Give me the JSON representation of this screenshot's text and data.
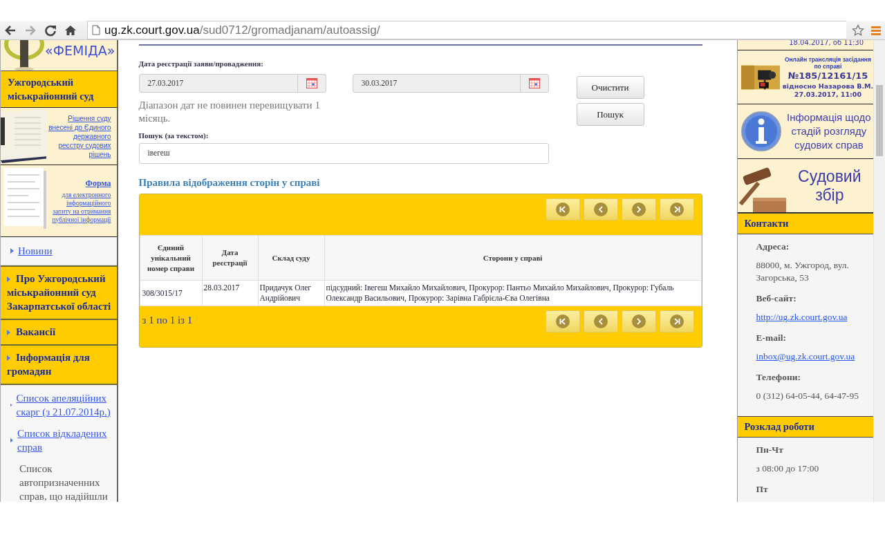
{
  "browser": {
    "url_host": "ug.zk.court.gov.ua",
    "url_path": "/sud0712/gromadjanam/autoassig/"
  },
  "left_sidebar": {
    "logo": "«ФЕМІДА»",
    "court_title": "Ужгородський міськрайонний суд",
    "banners": [
      {
        "kind": "book",
        "text": "Рішення суду внесені до Єдиного державного реєстру судових рішень"
      },
      {
        "kind": "form",
        "title": "Форма",
        "text": "для електронного інформаційного запиту на отримання публічної інформації"
      }
    ],
    "menu": [
      {
        "label": "Новини",
        "kind": "link"
      },
      {
        "label": "Про Ужгородський міськрайонний суд Закарпатської області",
        "kind": "section"
      },
      {
        "label": "Вакансії",
        "kind": "section"
      },
      {
        "label": "Інформація для громадян",
        "kind": "section",
        "children": [
          {
            "label": "Список апеляційних скарг (з 21.07.2014р.)",
            "kind": "link"
          },
          {
            "label": "Список відкладених справ",
            "kind": "link"
          },
          {
            "label": "Список автопризначенних справ, що надійшли",
            "kind": "current"
          }
        ]
      }
    ]
  },
  "form": {
    "date_label": "Дата реєстрації заяви/провадження:",
    "date_from": "27.03.2017",
    "date_to": "30.03.2017",
    "hint": "Діапазон дат не повинен перевищувати 1 місяць.",
    "text_label": "Пошук (за текстом):",
    "text_value": "івегеш",
    "buttons": [
      "Очистити",
      "Пошук"
    ]
  },
  "rules_link": "Правила відображення сторін у справі",
  "table": {
    "columns": [
      "Єдиний унікальний номер справи",
      "Дата реєстрації",
      "Склад суду",
      "Сторони у справі"
    ],
    "rows": [
      [
        "308/3015/17",
        "28.03.2017",
        "Придачук Олег Андрійович",
        "підсудний: Івегеш Михайло Михайлович, Прокурор: Пантьо Михайло Михайлович, Прокурор: Губаль Олександр Васильович, Прокурор: Зарівна Габрієла-Єва Олегівна"
      ]
    ],
    "pager_text": "з 1 по 1 із 1"
  },
  "right_sidebar": {
    "top_banner": "18.04.2017, об 11:30",
    "stream_banner": {
      "title": "Онлайн трансляція засідання по справі",
      "case": "№185/12161/15",
      "subject": "відносно Назарова В.М.",
      "date": "27.03.2017, 11:00"
    },
    "info_banner": "Інформація щодо стадій розгляду судових справ",
    "fee_banner": "Судовий збір",
    "sections": [
      {
        "heading": "Контакти",
        "items": [
          {
            "label": "Адреса:",
            "value": "88000, м. Ужгород, вул. Загорська, 53",
            "kind": "text"
          },
          {
            "label": "Веб-сайт:",
            "value": "http://ug.zk.court.gov.ua",
            "kind": "link"
          },
          {
            "label": "E-mail:",
            "value": "inbox@ug.zk.court.gov.ua",
            "kind": "link"
          },
          {
            "label": "Телефони:",
            "value": "0 (312) 64-05-44, 64-47-95",
            "kind": "text"
          }
        ]
      },
      {
        "heading": "Розклад роботи",
        "items": [
          {
            "label": "Пн-Чт",
            "value": "з 08:00 до 17:00",
            "kind": "text"
          },
          {
            "label": "Пт"
          }
        ]
      }
    ]
  }
}
